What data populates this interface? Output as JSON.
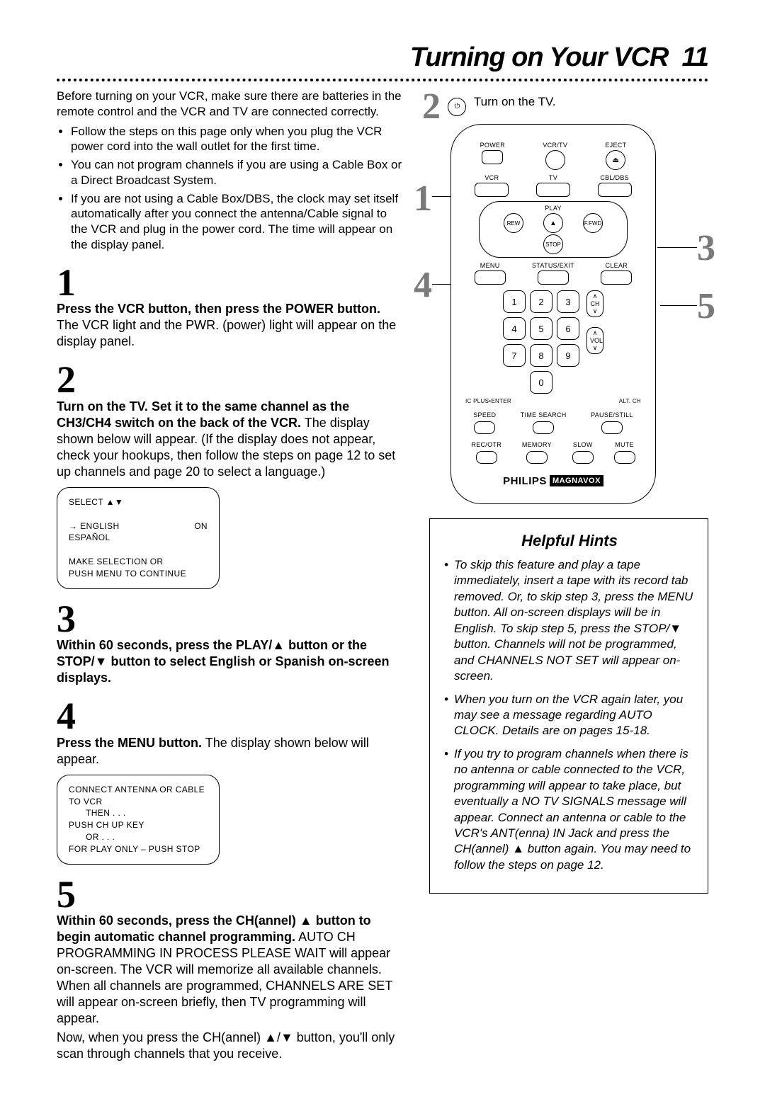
{
  "page": {
    "title": "Turning on Your VCR",
    "page_number": "11"
  },
  "intro": "Before turning on your VCR, make sure there are batteries in the remote control and the VCR and TV are connected correctly.",
  "intro_bullets": [
    "Follow the steps on this page only when you plug the VCR power cord into the wall outlet for the first time.",
    "You can not program channels if you are using a Cable Box or a Direct Broadcast System.",
    "If you are not using a Cable Box/DBS, the clock may set itself automatically after you connect the antenna/Cable signal to the VCR and plug in the power cord. The time will appear on the display panel."
  ],
  "steps": {
    "s1": {
      "num": "1",
      "head": "Press the VCR button, then press the POWER button.",
      "body": "The VCR light and the PWR. (power) light will appear on the display panel."
    },
    "s2": {
      "num": "2",
      "head": "Turn on the TV. Set it to the same channel as the CH3/CH4 switch on the back of the VCR.",
      "body": "The display shown below will appear. (If the display does not appear, check your hookups, then follow the steps on page 12 to set up channels and page 20 to select a language.)"
    },
    "s3": {
      "num": "3",
      "head": "Within 60 seconds, press the PLAY/▲ button or the STOP/▼ button to select English or Spanish on-screen displays."
    },
    "s4": {
      "num": "4",
      "head": "Press the MENU button.",
      "body": "The display shown below will appear."
    },
    "s5": {
      "num": "5",
      "head": "Within 60 seconds, press the CH(annel) ▲ button to begin automatic channel programming.",
      "body": "AUTO CH PROGRAMMING IN PROCESS PLEASE WAIT will appear on-screen. The VCR will memorize all available channels. When all channels are programmed, CHANNELS ARE SET will appear on-screen briefly, then TV programming will appear.",
      "tail": "Now, when you press the CH(annel) ▲/▼ button, you'll only scan through channels that you receive."
    }
  },
  "osd1": {
    "line1": "SELECT ▲▼",
    "en": "→ ENGLISH",
    "en_state": "ON",
    "es": "   ESPAÑOL",
    "foot1": "MAKE SELECTION OR",
    "foot2": "PUSH MENU TO CONTINUE"
  },
  "osd2": {
    "l1": "CONNECT ANTENNA OR CABLE",
    "l2": "TO VCR",
    "l3": "THEN . . .",
    "l4": "PUSH CH UP KEY",
    "l5": "OR . . .",
    "l6": "FOR PLAY ONLY – PUSH STOP"
  },
  "right_call": {
    "turn_on_tv": "Turn on the TV.",
    "nums": {
      "a": "2",
      "b": "1",
      "c": "4",
      "d": "3",
      "e": "5"
    }
  },
  "remote": {
    "row1": {
      "power": "POWER",
      "vcrtv": "VCR/TV",
      "eject": "EJECT"
    },
    "row2": {
      "vcr": "VCR",
      "tv": "TV",
      "cblDbs": "CBL/DBS"
    },
    "transport": {
      "play": "PLAY",
      "rew": "REW",
      "ffwd": "F.FWD",
      "stop": "STOP"
    },
    "row3": {
      "menu": "MENU",
      "status": "STATUS/EXIT",
      "clear": "CLEAR"
    },
    "keys": [
      "1",
      "2",
      "3",
      "4",
      "5",
      "6",
      "7",
      "8",
      "9",
      "0"
    ],
    "left_rocker": {
      "top": "∧",
      "mid": "CH",
      "bot": "∨"
    },
    "right_rocker": {
      "top": "∧",
      "mid": "VOL",
      "bot": "∨"
    },
    "labels": {
      "icplusenter": "IC PLUS•ENTER",
      "altch": "ALT. CH"
    },
    "bottom1": {
      "speed": "SPEED",
      "time": "TIME SEARCH",
      "pause": "PAUSE/STILL"
    },
    "bottom2": {
      "rec": "REC/OTR",
      "mem": "MEMORY",
      "slow": "SLOW",
      "mute": "MUTE"
    },
    "brand1": "PHILIPS",
    "brand2": "MAGNAVOX"
  },
  "hints": {
    "title": "Helpful Hints",
    "items": [
      "To skip this feature and play a tape immediately, insert a tape with its record tab removed. Or, to skip step 3, press the MENU button. All on-screen displays will be in English. To skip step 5, press the STOP/▼ button. Channels will not be programmed, and CHANNELS NOT SET will appear on-screen.",
      "When you turn on the VCR again later, you may see a message regarding AUTO CLOCK. Details are on pages 15-18.",
      "If you try to program channels when there is no antenna or cable connected to the VCR, programming will appear to take place, but eventually a NO TV SIGNALS message will appear. Connect an antenna or cable to the VCR's ANT(enna) IN Jack and press the CH(annel) ▲ button again. You may need to follow the steps on page 12."
    ]
  }
}
